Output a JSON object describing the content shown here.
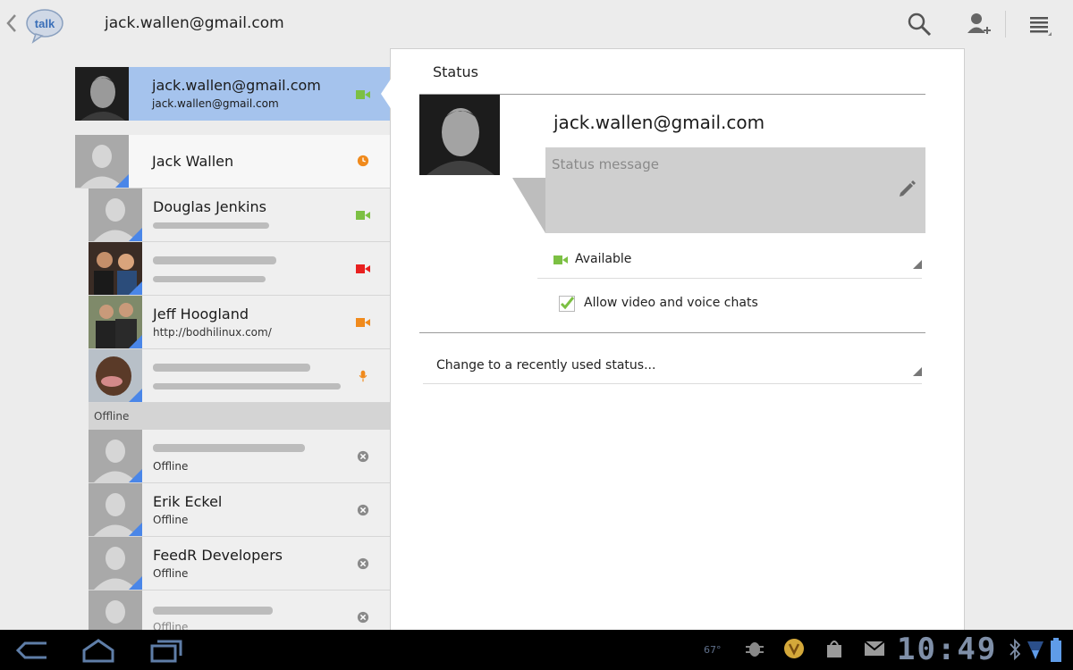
{
  "app": {
    "title": "jack.wallen@gmail.com",
    "logo_text": "talk"
  },
  "actions": {
    "search_icon": "search-icon",
    "add_icon": "add-contact-icon",
    "menu_icon": "menu-icon"
  },
  "self": {
    "name": "jack.wallen@gmail.com",
    "sub": "jack.wallen@gmail.com",
    "status": "video"
  },
  "contacts": [
    {
      "name": "Jack Wallen",
      "sub": "",
      "status": "idle",
      "status_color": "#f08a1c"
    },
    {
      "name": "Douglas Jenkins",
      "sub": "",
      "status": "video",
      "status_color": "#7cc043"
    },
    {
      "name": "",
      "sub": "",
      "status": "video-busy",
      "status_color": "#e8201f"
    },
    {
      "name": "Jeff Hoogland",
      "sub": "http://bodhilinux.com/",
      "status": "video-idle",
      "status_color": "#f08a1c"
    },
    {
      "name": "",
      "sub": "",
      "status": "voice",
      "status_color": "#f08a1c"
    }
  ],
  "offline_header": "Offline",
  "offline_contacts": [
    {
      "name": "",
      "sub": "Offline"
    },
    {
      "name": "Erik Eckel",
      "sub": "Offline"
    },
    {
      "name": "FeedR Developers",
      "sub": "Offline"
    },
    {
      "name": "",
      "sub": "Offline"
    }
  ],
  "detail": {
    "section_title": "Status",
    "profile_name": "jack.wallen@gmail.com",
    "status_placeholder": "Status message",
    "availability": "Available",
    "allow_label": "Allow video and voice chats",
    "allow_checked": true,
    "recent_label": "Change to a recently used status..."
  },
  "system": {
    "temperature": "67°",
    "clock": "10:49"
  },
  "colors": {
    "selected_row": "#a5c3ed",
    "available_green": "#7cc043"
  }
}
